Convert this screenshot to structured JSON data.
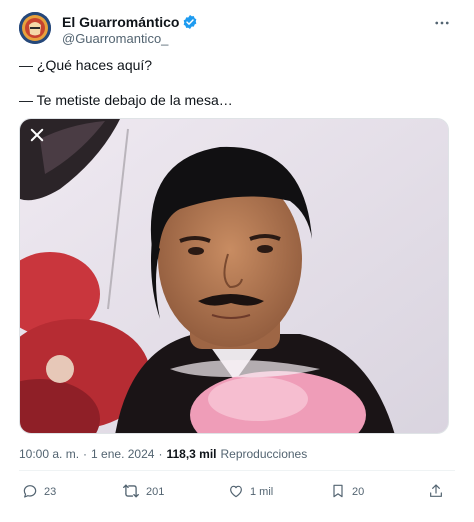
{
  "author": {
    "display_name": "El Guarromántico",
    "handle": "@Guarromantico_"
  },
  "tweet": {
    "line1": "— ¿Qué haces aquí?",
    "line2": "— Te metiste debajo de la mesa…"
  },
  "meta": {
    "time": "10:00 a. m.",
    "separator1": "·",
    "date": "1 ene. 2024",
    "separator2": "·",
    "views_count": "118,3 mil",
    "views_label": "Reproducciones"
  },
  "actions": {
    "replies": "23",
    "retweets": "201",
    "likes": "1 mil",
    "bookmarks": "20"
  },
  "icons": {
    "verified": "verified-badge-icon",
    "more": "more-icon",
    "close": "close-icon",
    "reply": "reply-icon",
    "retweet": "retweet-icon",
    "like": "heart-icon",
    "bookmark": "bookmark-icon",
    "share": "share-icon"
  },
  "colors": {
    "verified": "#1d9bf0",
    "text": "#0f1419",
    "secondary": "#536471"
  }
}
